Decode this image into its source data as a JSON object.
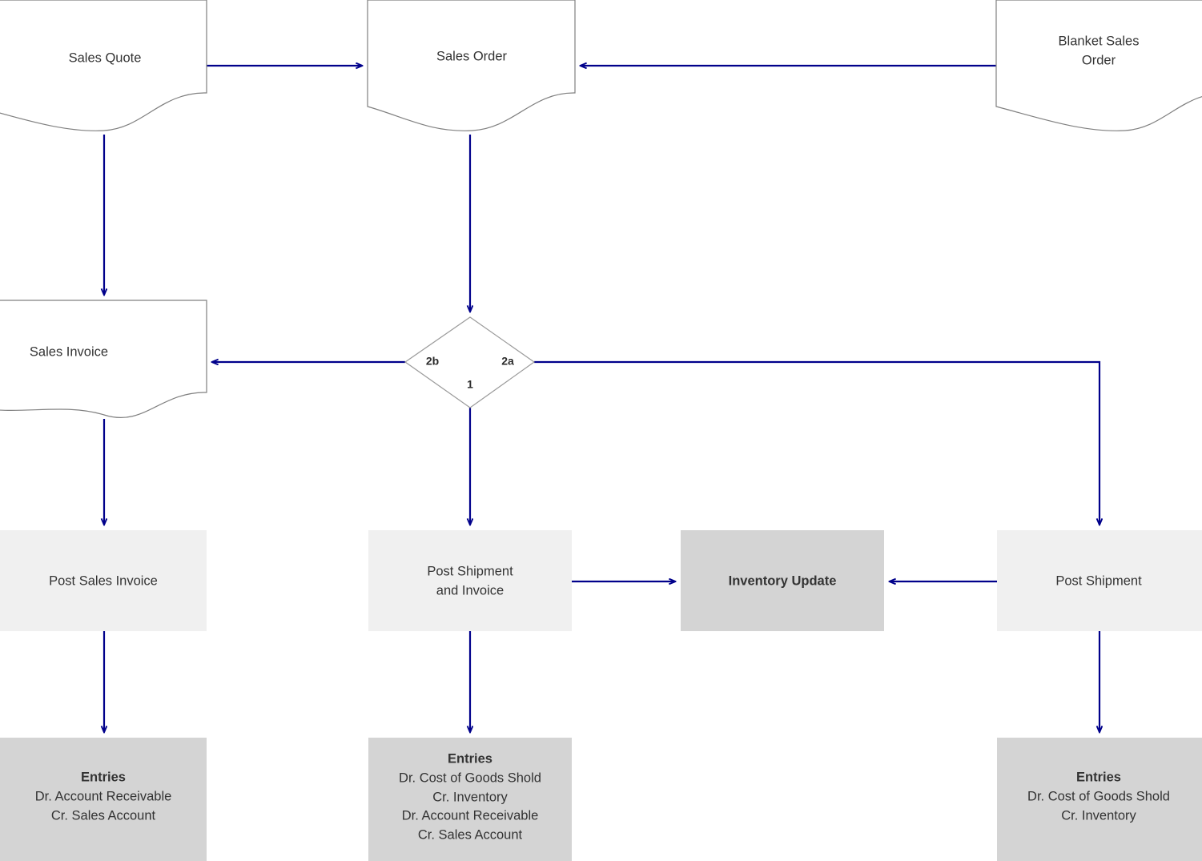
{
  "diagram": {
    "type": "flowchart",
    "title": "Sales Document and Posting Flow",
    "accent_color": "#00008b",
    "document_fill": "#ffffff",
    "document_stroke": "#808080",
    "process_fill": "#f0f0f0",
    "highlight_fill": "#d4d4d4",
    "text_color": "#333333"
  },
  "nodes": {
    "sales_quote": {
      "label": "Sales Quote",
      "shape": "document"
    },
    "sales_order": {
      "label": "Sales Order",
      "shape": "document"
    },
    "blanket_sales_order": {
      "label_line1": "Blanket Sales",
      "label_line2": "Order",
      "shape": "document"
    },
    "sales_invoice": {
      "label": "Sales Invoice",
      "shape": "document"
    },
    "decision": {
      "shape": "diamond",
      "branch_left": "2b",
      "branch_right": "2a",
      "branch_bottom": "1"
    },
    "post_sales_invoice": {
      "label": "Post Sales Invoice",
      "shape": "process"
    },
    "post_shipment_and_invoice": {
      "label_line1": "Post Shipment",
      "label_line2": "and Invoice",
      "shape": "process"
    },
    "inventory_update": {
      "label": "Inventory Update",
      "shape": "process-highlight"
    },
    "post_shipment": {
      "label": "Post Shipment",
      "shape": "process"
    },
    "entries_left": {
      "title": "Entries",
      "lines": [
        "Dr. Account Receivable",
        "Cr. Sales Account"
      ],
      "shape": "entries"
    },
    "entries_middle": {
      "title": "Entries",
      "lines": [
        "Dr. Cost of Goods Shold",
        "Cr. Inventory",
        "Dr. Account Receivable",
        "Cr. Sales Account"
      ],
      "shape": "entries"
    },
    "entries_right": {
      "title": "Entries",
      "lines": [
        "Dr. Cost of Goods Shold",
        "Cr. Inventory"
      ],
      "shape": "entries"
    }
  },
  "edges": [
    {
      "from": "sales_quote",
      "to": "sales_order",
      "direction": "right"
    },
    {
      "from": "blanket_sales_order",
      "to": "sales_order",
      "direction": "left"
    },
    {
      "from": "sales_quote",
      "to": "sales_invoice",
      "direction": "down"
    },
    {
      "from": "sales_order",
      "to": "decision",
      "direction": "down"
    },
    {
      "from": "decision",
      "to": "sales_invoice",
      "direction": "left",
      "label": "2b"
    },
    {
      "from": "decision",
      "to": "post_shipment",
      "direction": "right-down",
      "label": "2a"
    },
    {
      "from": "decision",
      "to": "post_shipment_and_invoice",
      "direction": "down",
      "label": "1"
    },
    {
      "from": "sales_invoice",
      "to": "post_sales_invoice",
      "direction": "down"
    },
    {
      "from": "post_sales_invoice",
      "to": "entries_left",
      "direction": "down"
    },
    {
      "from": "post_shipment_and_invoice",
      "to": "inventory_update",
      "direction": "right"
    },
    {
      "from": "post_shipment_and_invoice",
      "to": "entries_middle",
      "direction": "down"
    },
    {
      "from": "post_shipment",
      "to": "inventory_update",
      "direction": "left"
    },
    {
      "from": "post_shipment",
      "to": "entries_right",
      "direction": "down"
    }
  ]
}
